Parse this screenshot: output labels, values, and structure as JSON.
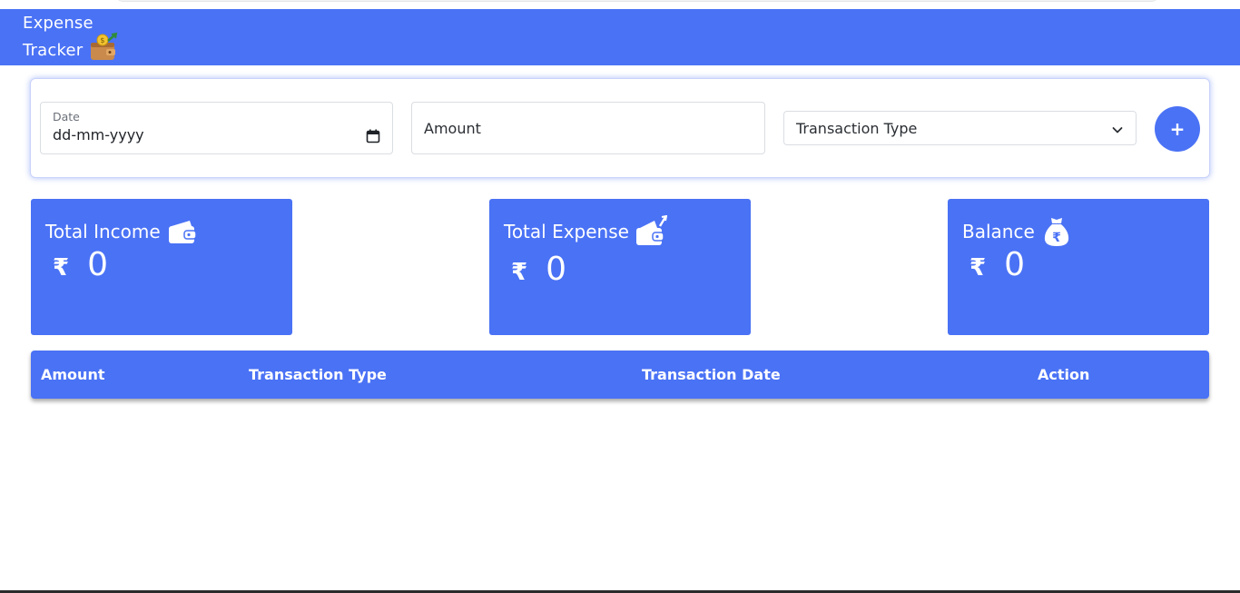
{
  "app": {
    "title_line1": "Expense",
    "title_line2": "Tracker",
    "brand_icon": "wallet-money-icon",
    "accent_color": "#4a72f5"
  },
  "form": {
    "date_label": "Date",
    "date_value": "dd-mm-yyyy",
    "amount_placeholder": "Amount",
    "transaction_type_selected": "Transaction Type",
    "add_button_label": "+"
  },
  "cards": {
    "income": {
      "title": "Total Income",
      "currency": "₹",
      "value": "0",
      "icon": "wallet-icon"
    },
    "expense": {
      "title": "Total Expense",
      "currency": "₹",
      "value": "0",
      "icon": "wallet-out-icon"
    },
    "balance": {
      "title": "Balance",
      "currency": "₹",
      "value": "0",
      "icon": "money-bag-icon"
    }
  },
  "table": {
    "headers": [
      "Amount",
      "Transaction Type",
      "Transaction Date",
      "Action"
    ]
  }
}
